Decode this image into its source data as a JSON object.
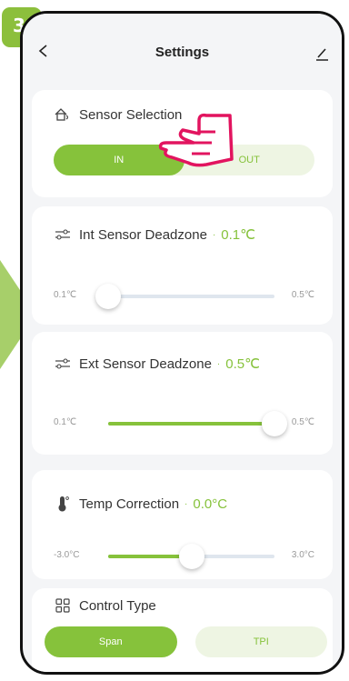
{
  "step_number": "3",
  "header": {
    "title": "Settings"
  },
  "sensor_selection": {
    "title": "Sensor Selection",
    "options": [
      {
        "label": "IN",
        "active": true
      },
      {
        "label": "OUT",
        "active": false
      }
    ]
  },
  "int_deadzone": {
    "title": "Int Sensor Deadzone",
    "value": "0.1℃",
    "min": "0.1℃",
    "max": "0.5℃",
    "level": 0.0
  },
  "ext_deadzone": {
    "title": "Ext Sensor Deadzone",
    "value": "0.5℃",
    "min": "0.1℃",
    "max": "0.5℃",
    "level": 1.0
  },
  "temp_correction": {
    "title": "Temp Correction",
    "value": "0.0°C",
    "min": "-3.0°C",
    "max": "3.0°C",
    "level": 0.5
  },
  "control_type": {
    "title": "Control Type",
    "options": [
      {
        "label": "Span",
        "active": true
      },
      {
        "label": "TPI",
        "active": false
      }
    ]
  },
  "colors": {
    "accent": "#86c23b",
    "badge": "#8cbf3c",
    "pointer": "#e2145f"
  }
}
